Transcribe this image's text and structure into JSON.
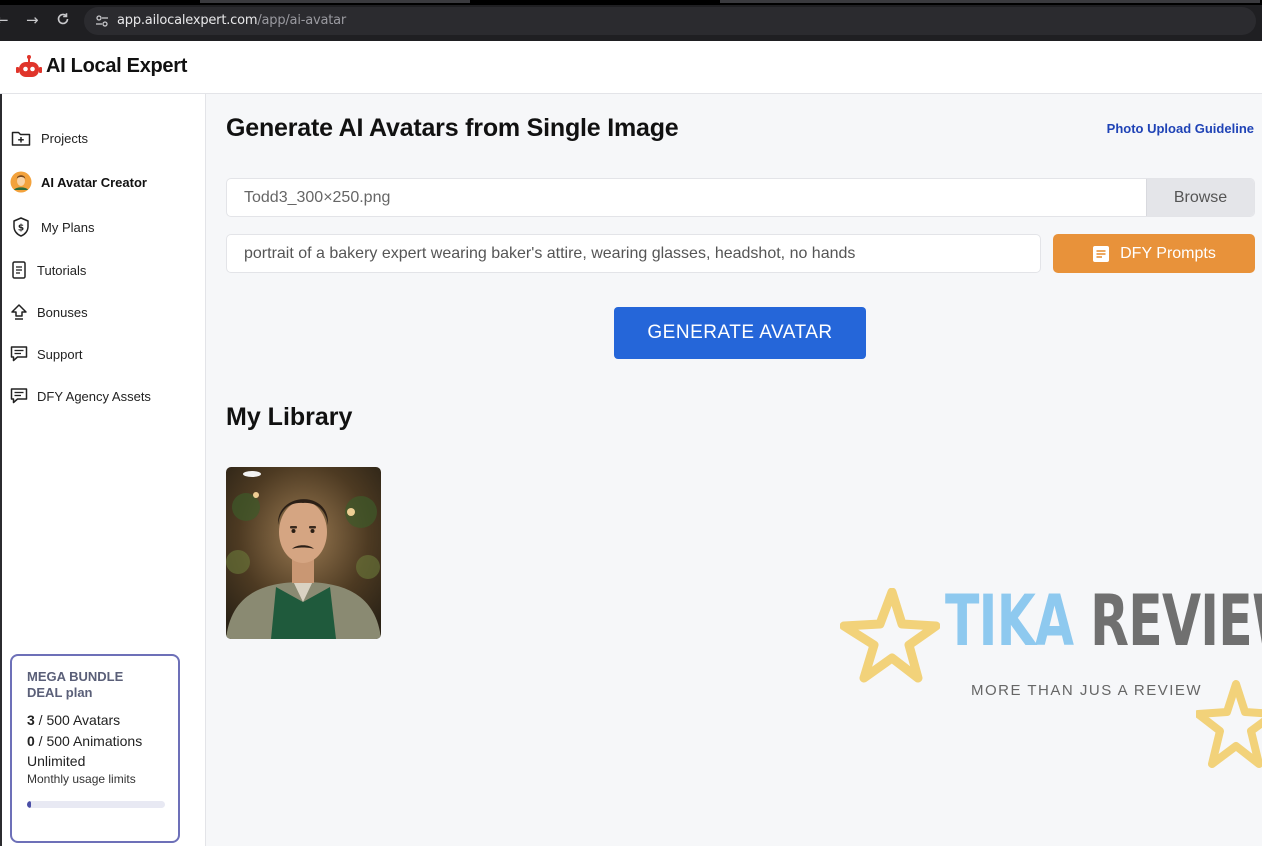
{
  "browser": {
    "url_host": "app.ailocalexpert.com",
    "url_path": "/app/ai-avatar"
  },
  "app": {
    "name": "AI Local Expert",
    "brand_color": "#e0352b"
  },
  "sidebar": {
    "items": [
      {
        "label": "Projects",
        "icon": "folder-plus-icon"
      },
      {
        "label": "AI Avatar Creator",
        "icon": "avatar-icon",
        "active": true
      },
      {
        "label": "My Plans",
        "icon": "dollar-shield-icon"
      },
      {
        "label": "Tutorials",
        "icon": "document-icon"
      },
      {
        "label": "Bonuses",
        "icon": "up-arrow-icon"
      },
      {
        "label": "Support",
        "icon": "chat-icon"
      },
      {
        "label": "DFY Agency Assets",
        "icon": "chat-icon"
      }
    ],
    "plan": {
      "title_upper": "MEGA BUNDLE",
      "title_lower": "DEAL plan",
      "avatars_used": "3",
      "avatars_total": " / 500 Avatars",
      "animations_used": "0",
      "animations_total": " / 500 Animations",
      "unlimited": "Unlimited",
      "note": "Monthly usage limits",
      "usage_fraction": 0.006
    }
  },
  "main": {
    "title": "Generate AI Avatars from Single Image",
    "guide_link": "Photo Upload Guideline",
    "file_name": "Todd3_300×250.png",
    "browse_label": "Browse",
    "prompt_value": "portrait of a bakery expert wearing baker's attire, wearing glasses, headshot, no hands",
    "dfy_label": "DFY Prompts",
    "generate_label": "GENERATE AVATAR",
    "library_title": "My Library",
    "colors": {
      "generate": "#2566d9",
      "dfy": "#e8923a",
      "link": "#1f43b6"
    }
  },
  "watermark": {
    "word1": "TIKA",
    "word2": "REVIEW",
    "tagline": "MORE THAN JUS A REVIEW"
  }
}
